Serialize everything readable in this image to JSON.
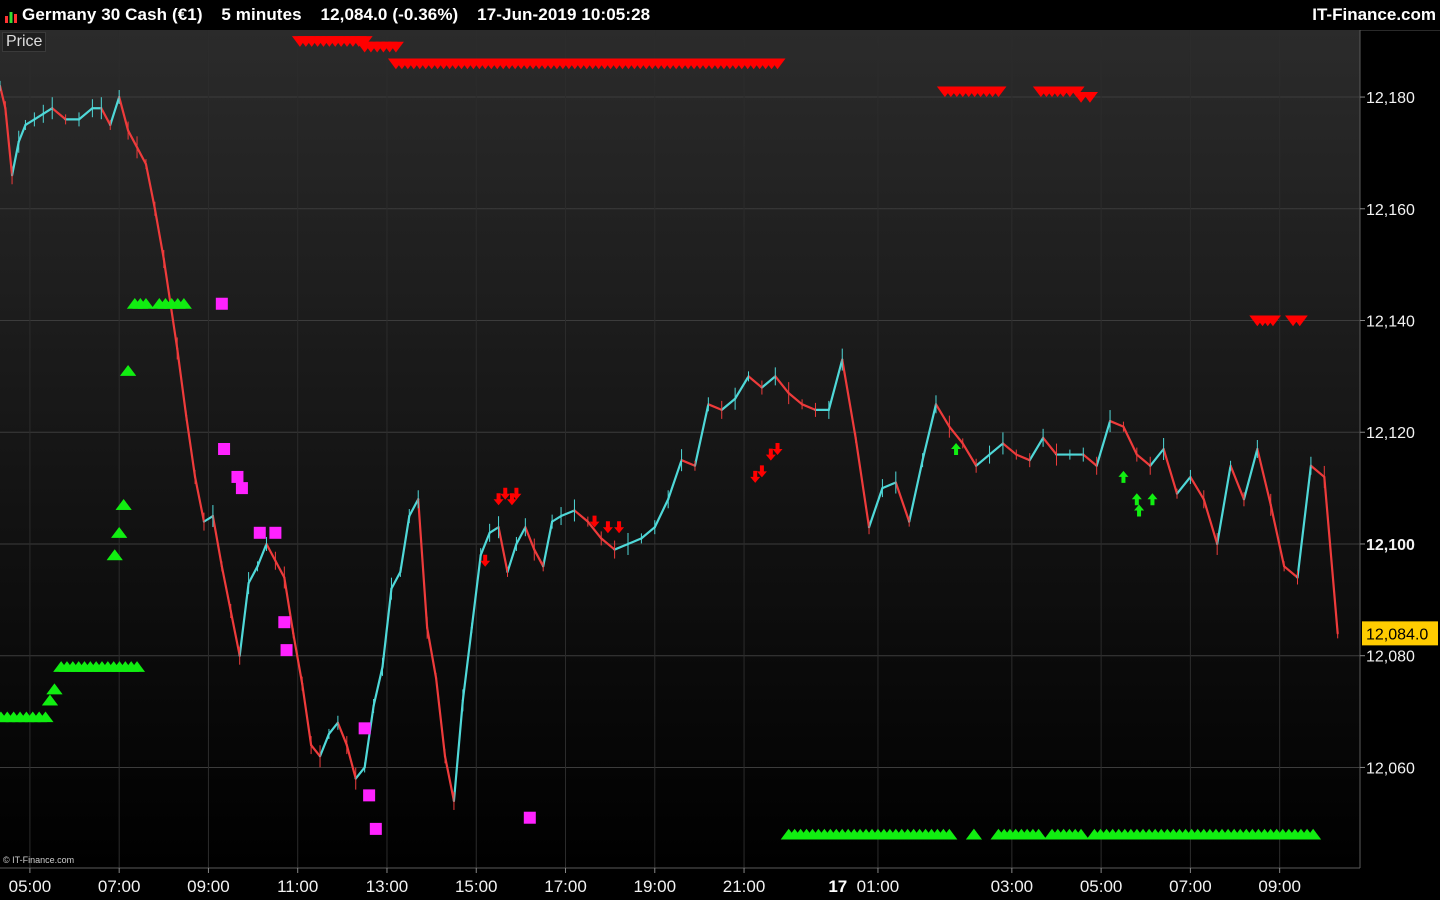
{
  "header": {
    "instrument": "Germany 30 Cash (€1)",
    "timeframe": "5 minutes",
    "price_change": "12,084.0 (-0.36%)",
    "datetime": "17-Jun-2019 10:05:28",
    "brand": "IT-Finance.com"
  },
  "panel_label": "Price",
  "copyright": "© IT-Finance.com",
  "colors": {
    "background_top": "#2b2b2b",
    "background_bottom": "#000000",
    "up_candle": "#4fd8d8",
    "down_candle": "#ee3b3b",
    "green_marker": "#11ee11",
    "red_marker": "#ff0000",
    "magenta_marker": "#ff22ff",
    "last_price_bg": "#ffcc00"
  },
  "chart_data": {
    "type": "line",
    "ylim": [
      12042,
      12192
    ],
    "xlim": [
      4.33,
      34.8
    ],
    "yticks": [
      12060,
      12080,
      12100,
      12120,
      12140,
      12160,
      12180
    ],
    "ytick_labels": [
      "12,060",
      "12,080",
      "12,100",
      "12,120",
      "12,140",
      "12,160",
      "12,180"
    ],
    "bold_ytick": "12,100",
    "last_price": 12084.0,
    "last_price_label": "12,084.0",
    "xticks": [
      5,
      7,
      9,
      11,
      13,
      15,
      17,
      19,
      21,
      24,
      27,
      29,
      31,
      33
    ],
    "xtick_labels": [
      "05:00",
      "07:00",
      "09:00",
      "11:00",
      "13:00",
      "15:00",
      "17:00",
      "19:00",
      "21:00",
      "01:00",
      "03:00",
      "05:00",
      "07:00",
      "09:00"
    ],
    "day_marker": {
      "x": 23.1,
      "label": "17"
    },
    "price_series": {
      "name": "",
      "x": [
        4.33,
        4.45,
        4.6,
        4.75,
        4.9,
        5.1,
        5.3,
        5.5,
        5.8,
        6.1,
        6.4,
        6.6,
        6.8,
        7.0,
        7.2,
        7.4,
        7.6,
        7.8,
        8.0,
        8.3,
        8.5,
        8.7,
        8.9,
        9.1,
        9.3,
        9.5,
        9.7,
        9.9,
        10.1,
        10.3,
        10.5,
        10.7,
        10.9,
        11.1,
        11.3,
        11.5,
        11.7,
        11.9,
        12.1,
        12.3,
        12.5,
        12.7,
        12.9,
        13.1,
        13.3,
        13.5,
        13.7,
        13.9,
        14.1,
        14.3,
        14.5,
        14.7,
        14.9,
        15.1,
        15.3,
        15.5,
        15.7,
        15.9,
        16.1,
        16.3,
        16.5,
        16.7,
        16.9,
        17.2,
        17.5,
        17.8,
        18.1,
        18.4,
        18.7,
        19.0,
        19.3,
        19.6,
        19.9,
        20.2,
        20.5,
        20.8,
        21.1,
        21.4,
        21.7,
        22.0,
        22.3,
        22.6,
        22.9,
        23.2,
        23.5,
        23.8,
        24.1,
        24.4,
        24.7,
        25.0,
        25.3,
        25.6,
        25.9,
        26.2,
        26.5,
        26.8,
        27.1,
        27.4,
        27.7,
        28.0,
        28.3,
        28.6,
        28.9,
        29.2,
        29.5,
        29.8,
        30.1,
        30.4,
        30.7,
        31.0,
        31.3,
        31.6,
        31.9,
        32.2,
        32.5,
        32.8,
        33.1,
        33.4,
        33.7,
        34.0,
        34.3
      ],
      "y": [
        12182,
        12178,
        12166,
        12172,
        12175,
        12176,
        12177,
        12178,
        12176,
        12176,
        12178,
        12178,
        12175,
        12180,
        12174,
        12171,
        12168,
        12160,
        12151,
        12135,
        12123,
        12112,
        12104,
        12105,
        12096,
        12088,
        12080,
        12093,
        12096,
        12100,
        12097,
        12094,
        12084,
        12075,
        12064,
        12062,
        12066,
        12068,
        12064,
        12058,
        12060,
        12071,
        12078,
        12092,
        12095,
        12105,
        12108,
        12085,
        12076,
        12062,
        12054,
        12072,
        12085,
        12098,
        12102,
        12103,
        12095,
        12100,
        12103,
        12099,
        12096,
        12104,
        12105,
        12106,
        12104,
        12101,
        12099,
        12100,
        12101,
        12103,
        12108,
        12115,
        12114,
        12125,
        12124,
        12126,
        12130,
        12128,
        12130,
        12127,
        12125,
        12124,
        12124,
        12133,
        12119,
        12103,
        12110,
        12111,
        12104,
        12115,
        12125,
        12121,
        12118,
        12114,
        12116,
        12118,
        12116,
        12115,
        12119,
        12116,
        12116,
        12116,
        12114,
        12122,
        12121,
        12116,
        12114,
        12117,
        12109,
        12112,
        12108,
        12100,
        12114,
        12108,
        12117,
        12107,
        12096,
        12094,
        12114,
        12112,
        12084
      ]
    },
    "red_triangles_down": [
      {
        "x1": 11.05,
        "x2": 12.5,
        "y": 12190
      },
      {
        "x1": 12.5,
        "x2": 13.2,
        "y": 12189
      },
      {
        "x1": 13.2,
        "x2": 21.75,
        "y": 12186
      },
      {
        "x1": 25.5,
        "x2": 26.7,
        "y": 12181
      },
      {
        "x1": 27.65,
        "x2": 28.15,
        "y": 12181
      },
      {
        "x1": 28.3,
        "x2": 28.45,
        "y": 12181
      },
      {
        "x1": 28.55,
        "x2": 28.75,
        "y": 12180
      },
      {
        "x1": 32.5,
        "x2": 32.85,
        "y": 12140
      },
      {
        "x1": 33.3,
        "x2": 33.45,
        "y": 12140
      }
    ],
    "green_triangles_up": [
      {
        "x1": 4.35,
        "x2": 5.35,
        "y": 12069
      },
      {
        "x1": 5.45,
        "x2": 5.45,
        "y": 12072
      },
      {
        "x1": 5.55,
        "x2": 5.55,
        "y": 12074
      },
      {
        "x1": 5.7,
        "x2": 7.4,
        "y": 12078
      },
      {
        "x1": 6.9,
        "x2": 6.9,
        "y": 12098
      },
      {
        "x1": 7.0,
        "x2": 7.0,
        "y": 12102
      },
      {
        "x1": 7.1,
        "x2": 7.1,
        "y": 12107
      },
      {
        "x1": 7.2,
        "x2": 7.2,
        "y": 12131
      },
      {
        "x1": 7.35,
        "x2": 7.6,
        "y": 12143
      },
      {
        "x1": 7.9,
        "x2": 8.45,
        "y": 12143
      },
      {
        "x1": 22.0,
        "x2": 25.6,
        "y": 12048
      },
      {
        "x1": 26.15,
        "x2": 26.15,
        "y": 12048
      },
      {
        "x1": 26.7,
        "x2": 27.6,
        "y": 12048
      },
      {
        "x1": 27.9,
        "x2": 28.55,
        "y": 12048
      },
      {
        "x1": 28.85,
        "x2": 33.75,
        "y": 12048
      }
    ],
    "magenta_squares": [
      {
        "x": 9.3,
        "y": 12143
      },
      {
        "x": 9.35,
        "y": 12117
      },
      {
        "x": 9.65,
        "y": 12112
      },
      {
        "x": 9.75,
        "y": 12110
      },
      {
        "x": 10.15,
        "y": 12102
      },
      {
        "x": 10.5,
        "y": 12102
      },
      {
        "x": 10.7,
        "y": 12086
      },
      {
        "x": 10.75,
        "y": 12081
      },
      {
        "x": 12.5,
        "y": 12067
      },
      {
        "x": 12.6,
        "y": 12055
      },
      {
        "x": 12.75,
        "y": 12049
      },
      {
        "x": 16.2,
        "y": 12051
      }
    ],
    "red_arrows_down": [
      {
        "x": 15.2,
        "y": 12097
      },
      {
        "x": 15.5,
        "y": 12108
      },
      {
        "x": 15.65,
        "y": 12109
      },
      {
        "x": 15.8,
        "y": 12108
      },
      {
        "x": 15.9,
        "y": 12109
      },
      {
        "x": 17.65,
        "y": 12104
      },
      {
        "x": 17.95,
        "y": 12103
      },
      {
        "x": 18.2,
        "y": 12103
      },
      {
        "x": 21.25,
        "y": 12112
      },
      {
        "x": 21.4,
        "y": 12113
      },
      {
        "x": 21.6,
        "y": 12116
      },
      {
        "x": 21.75,
        "y": 12117
      }
    ],
    "green_arrows_up": [
      {
        "x": 25.75,
        "y": 12117
      },
      {
        "x": 29.5,
        "y": 12112
      },
      {
        "x": 29.8,
        "y": 12108
      },
      {
        "x": 29.85,
        "y": 12106
      },
      {
        "x": 30.15,
        "y": 12108
      }
    ]
  }
}
